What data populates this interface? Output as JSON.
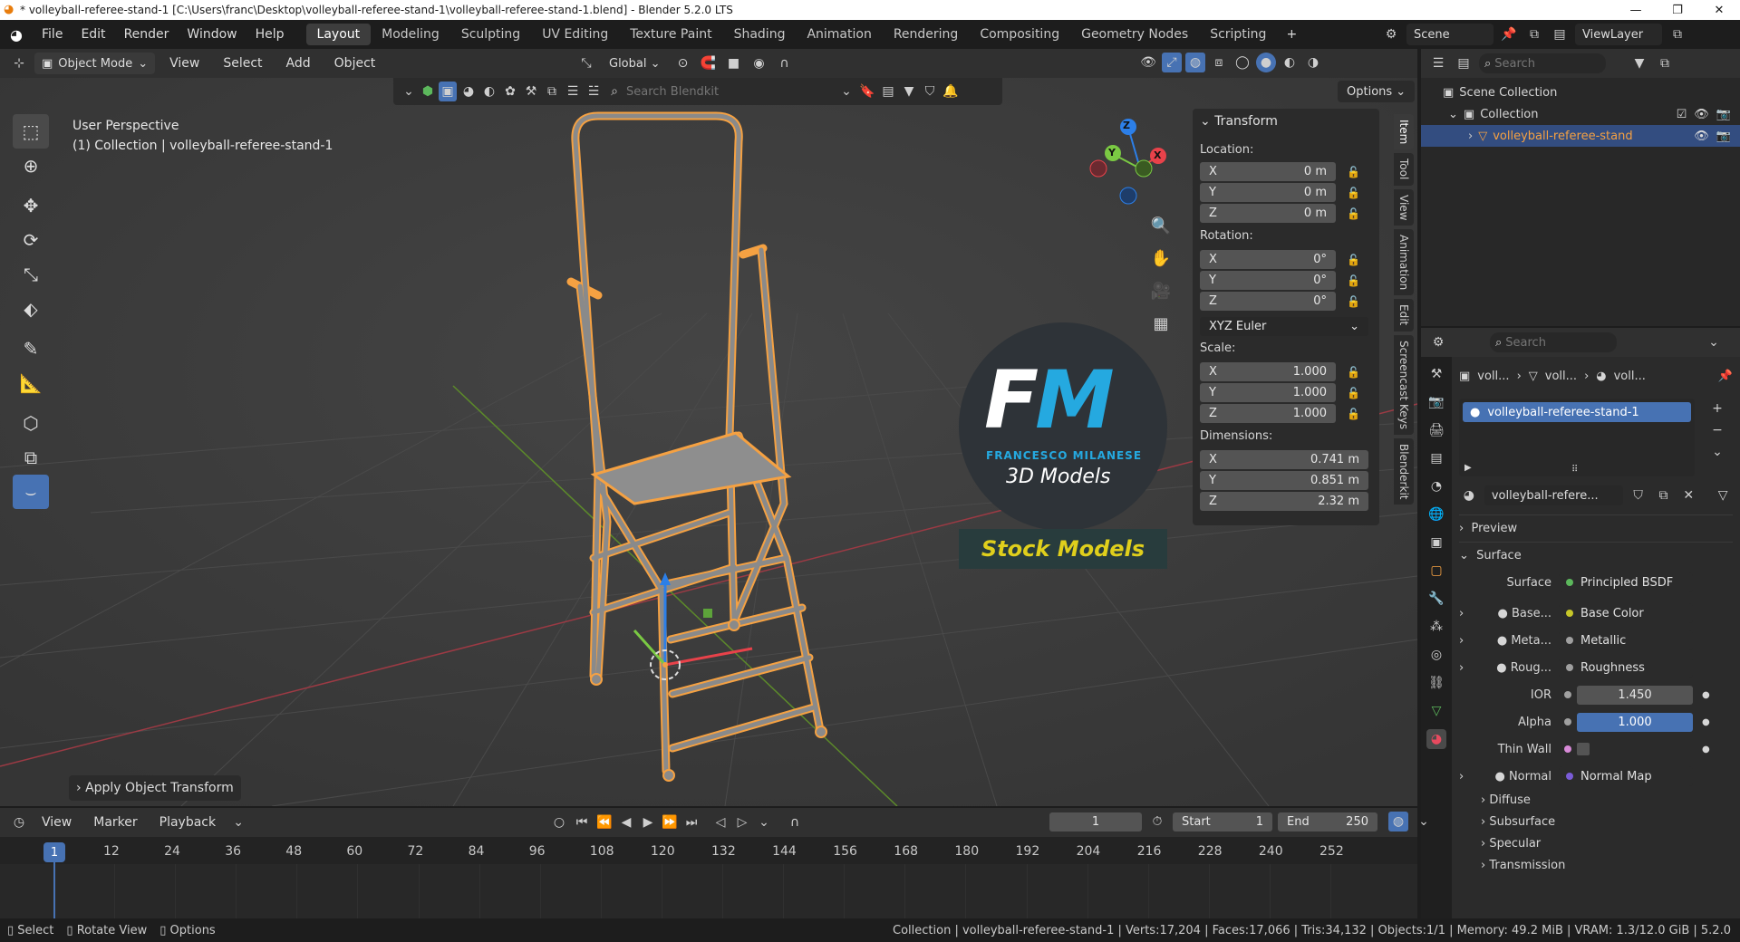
{
  "window": {
    "title": "* volleyball-referee-stand-1 [C:\\Users\\franc\\Desktop\\volleyball-referee-stand-1\\volleyball-referee-stand-1.blend] - Blender 5.2.0 LTS"
  },
  "menus": [
    "File",
    "Edit",
    "Render",
    "Window",
    "Help"
  ],
  "workspaces": [
    "Layout",
    "Modeling",
    "Sculpting",
    "UV Editing",
    "Texture Paint",
    "Shading",
    "Animation",
    "Rendering",
    "Compositing",
    "Geometry Nodes",
    "Scripting"
  ],
  "active_workspace": "Layout",
  "scene": {
    "name": "Scene",
    "view_layer": "ViewLayer"
  },
  "viewport_header": {
    "mode": "Object Mode",
    "menus": [
      "View",
      "Select",
      "Add",
      "Object"
    ],
    "orientation": "Global"
  },
  "blenderkit": {
    "search_placeholder": "Search Blendkit",
    "options_label": "Options"
  },
  "viewport": {
    "view_name": "User Perspective",
    "collection_info": "(1) Collection | volleyball-referee-stand-1",
    "last_operator": "Apply Object Transform",
    "gizmo_axes": {
      "x": "X",
      "y": "Y",
      "z": "Z"
    },
    "watermark": {
      "initials": "FM",
      "author": "FRANCESCO MILANESE",
      "subtitle": "3D Models",
      "banner": "Stock Models"
    }
  },
  "transform_panel": {
    "title": "Transform",
    "location_label": "Location:",
    "location": [
      {
        "axis": "X",
        "value": "0 m"
      },
      {
        "axis": "Y",
        "value": "0 m"
      },
      {
        "axis": "Z",
        "value": "0 m"
      }
    ],
    "rotation_label": "Rotation:",
    "rotation": [
      {
        "axis": "X",
        "value": "0°"
      },
      {
        "axis": "Y",
        "value": "0°"
      },
      {
        "axis": "Z",
        "value": "0°"
      }
    ],
    "rotation_mode": "XYZ Euler",
    "scale_label": "Scale:",
    "scale": [
      {
        "axis": "X",
        "value": "1.000"
      },
      {
        "axis": "Y",
        "value": "1.000"
      },
      {
        "axis": "Z",
        "value": "1.000"
      }
    ],
    "dimensions_label": "Dimensions:",
    "dimensions": [
      {
        "axis": "X",
        "value": "0.741 m"
      },
      {
        "axis": "Y",
        "value": "0.851 m"
      },
      {
        "axis": "Z",
        "value": "2.32 m"
      }
    ]
  },
  "sidebar_tabs": [
    "Item",
    "Tool",
    "View",
    "Animation",
    "Edit",
    "Screencast Keys",
    "Blenderkit"
  ],
  "outliner": {
    "search_placeholder": "Search",
    "scene_collection": "Scene Collection",
    "collection": "Collection",
    "object": "volleyball-referee-stand"
  },
  "properties": {
    "search_placeholder": "Search",
    "breadcrumb": [
      "voll...",
      "voll...",
      "voll..."
    ],
    "material_slot": "volleyball-referee-stand-1",
    "material_name": "volleyball-refere...",
    "sections": {
      "preview": "Preview",
      "surface": "Surface"
    },
    "surface_label": "Surface",
    "surface_value": "Principled BSDF",
    "inputs": [
      {
        "label": "Base...",
        "value": "Base Color",
        "dot": "#c7c729",
        "expand": true
      },
      {
        "label": "Meta...",
        "value": "Metallic",
        "dot": "#a0a0a0",
        "expand": true
      },
      {
        "label": "Roug...",
        "value": "Roughness",
        "dot": "#a0a0a0",
        "expand": true
      }
    ],
    "ior": {
      "label": "IOR",
      "value": "1.450"
    },
    "alpha": {
      "label": "Alpha",
      "value": "1.000"
    },
    "thin_wall": {
      "label": "Thin Wall"
    },
    "normal": {
      "label": "Normal",
      "value": "Normal Map"
    },
    "subpanels": [
      "Diffuse",
      "Subsurface",
      "Specular",
      "Transmission"
    ]
  },
  "timeline": {
    "menus": [
      "View",
      "Marker",
      "Playback"
    ],
    "current_frame": "1",
    "start_label": "Start",
    "start": "1",
    "end_label": "End",
    "end": "250",
    "ticks": [
      "12",
      "24",
      "36",
      "48",
      "60",
      "72",
      "84",
      "96",
      "108",
      "120",
      "132",
      "144",
      "156",
      "168",
      "180",
      "192",
      "204",
      "216",
      "228",
      "240",
      "252"
    ],
    "playhead": "1"
  },
  "statusbar": {
    "select": "Select",
    "rotate": "Rotate View",
    "options": "Options",
    "stats": "Collection | volleyball-referee-stand-1 | Verts:17,204 | Faces:17,066 | Tris:34,132 | Objects:1/1 | Memory: 49.2 MiB | VRAM: 1.3/12.0 GiB | 5.2.0"
  },
  "colors": {
    "accent": "#4772b3",
    "selection": "#f5a142",
    "header": "#303030",
    "viewport": "#3d3d3d"
  }
}
